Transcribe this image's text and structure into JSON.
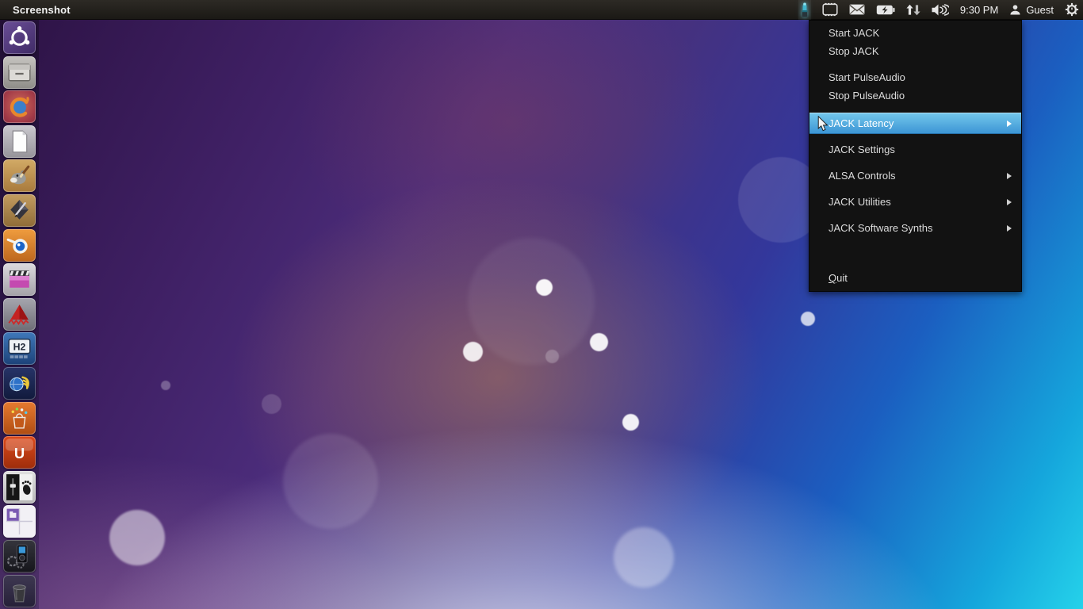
{
  "panel": {
    "title": "Screenshot",
    "clock": "9:30 PM",
    "user_label": "Guest"
  },
  "tray": {
    "icons": [
      {
        "name": "jack-indicator-icon",
        "active": true
      },
      {
        "name": "film-frame-icon"
      },
      {
        "name": "mail-icon"
      },
      {
        "name": "battery-icon"
      },
      {
        "name": "network-arrows-icon"
      },
      {
        "name": "volume-icon"
      },
      {
        "name": "user-icon"
      },
      {
        "name": "session-gear-icon"
      }
    ]
  },
  "menu": {
    "items": [
      {
        "label": "Start JACK",
        "has_submenu": false,
        "highlighted": false
      },
      {
        "label": "Stop JACK",
        "has_submenu": false,
        "highlighted": false
      },
      {
        "label": "Start PulseAudio",
        "has_submenu": false,
        "highlighted": false
      },
      {
        "label": "Stop PulseAudio",
        "has_submenu": false,
        "highlighted": false
      },
      {
        "label": "JACK Latency",
        "has_submenu": true,
        "highlighted": true
      },
      {
        "label": "JACK Settings",
        "has_submenu": false,
        "highlighted": false
      },
      {
        "label": "ALSA Controls",
        "has_submenu": true,
        "highlighted": false
      },
      {
        "label": "JACK Utilities",
        "has_submenu": true,
        "highlighted": false
      },
      {
        "label": "JACK Software Synths",
        "has_submenu": true,
        "highlighted": false
      },
      {
        "label": "Quit",
        "has_submenu": false,
        "highlighted": false,
        "mnemonic": "Q"
      }
    ]
  },
  "launcher": {
    "items": [
      {
        "name": "dash-home",
        "icon": "ubuntu-logo-icon"
      },
      {
        "name": "file-manager",
        "icon": "file-cabinet-icon"
      },
      {
        "name": "firefox",
        "icon": "firefox-icon"
      },
      {
        "name": "libreoffice",
        "icon": "document-icon"
      },
      {
        "name": "gimp",
        "icon": "gimp-icon"
      },
      {
        "name": "inkscape",
        "icon": "inkscape-icon"
      },
      {
        "name": "blender",
        "icon": "blender-icon"
      },
      {
        "name": "video-editor",
        "icon": "clapperboard-icon"
      },
      {
        "name": "audio-workstation",
        "icon": "red-pyramid-wave-icon"
      },
      {
        "name": "hydrogen-drum-machine",
        "icon": "h2-icon",
        "badge": "H2"
      },
      {
        "name": "globe-wing-app",
        "icon": "globe-wing-icon"
      },
      {
        "name": "software-center",
        "icon": "shopping-bag-icon"
      },
      {
        "name": "ubuntu-one",
        "icon": "ubuntu-one-icon",
        "badge": "U"
      },
      {
        "name": "audio-mixer",
        "icon": "mixer-foot-icon"
      },
      {
        "name": "workspace-switcher",
        "icon": "workspaces-icon"
      },
      {
        "name": "media-device-manager",
        "icon": "media-device-icon"
      },
      {
        "name": "trash",
        "icon": "trash-icon"
      }
    ]
  },
  "colors": {
    "menu_highlight_top": "#74c8ec",
    "menu_highlight_bottom": "#3b94d4",
    "menu_background": "#121212",
    "menu_text": "#dcdcdc",
    "panel_background": "#231f1b",
    "jack_indicator_teal": "#3fb4cc",
    "wallpaper_top_left": "#2c1243",
    "wallpaper_bottom_right": "#25d2ea"
  }
}
